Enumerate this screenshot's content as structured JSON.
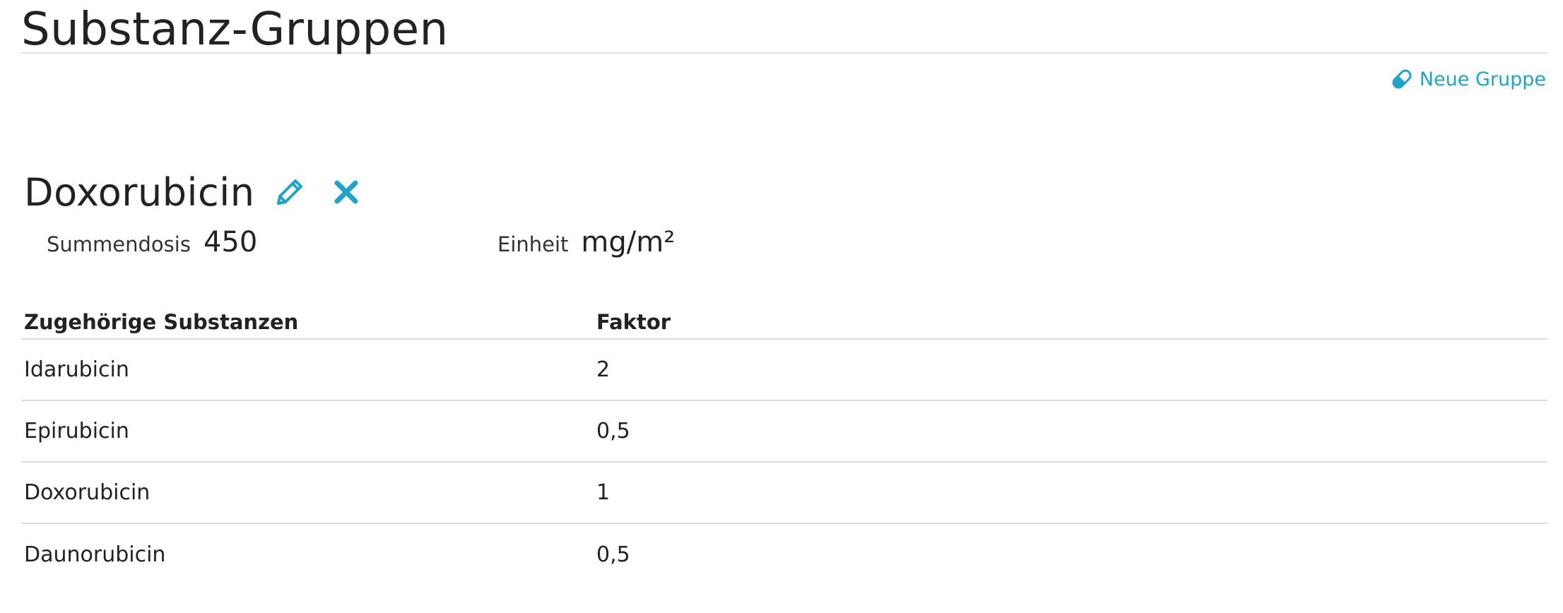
{
  "page": {
    "title": "Substanz-Gruppen",
    "new_group_label": "Neue Gruppe",
    "new_group_icon": "pill-icon",
    "accent_color": "#1fa3c8"
  },
  "group": {
    "name": "Doxorubicin",
    "edit_icon": "pencil-icon",
    "delete_icon": "close-icon",
    "sum_dose_label": "Summendosis",
    "sum_dose_value": "450",
    "unit_label": "Einheit",
    "unit_value": "mg/m²"
  },
  "table": {
    "headers": {
      "substance": "Zugehörige Substanzen",
      "factor": "Faktor"
    },
    "rows": [
      {
        "substance": "Idarubicin",
        "factor": "2"
      },
      {
        "substance": "Epirubicin",
        "factor": "0,5"
      },
      {
        "substance": "Doxorubicin",
        "factor": "1"
      },
      {
        "substance": "Daunorubicin",
        "factor": "0,5"
      }
    ]
  }
}
